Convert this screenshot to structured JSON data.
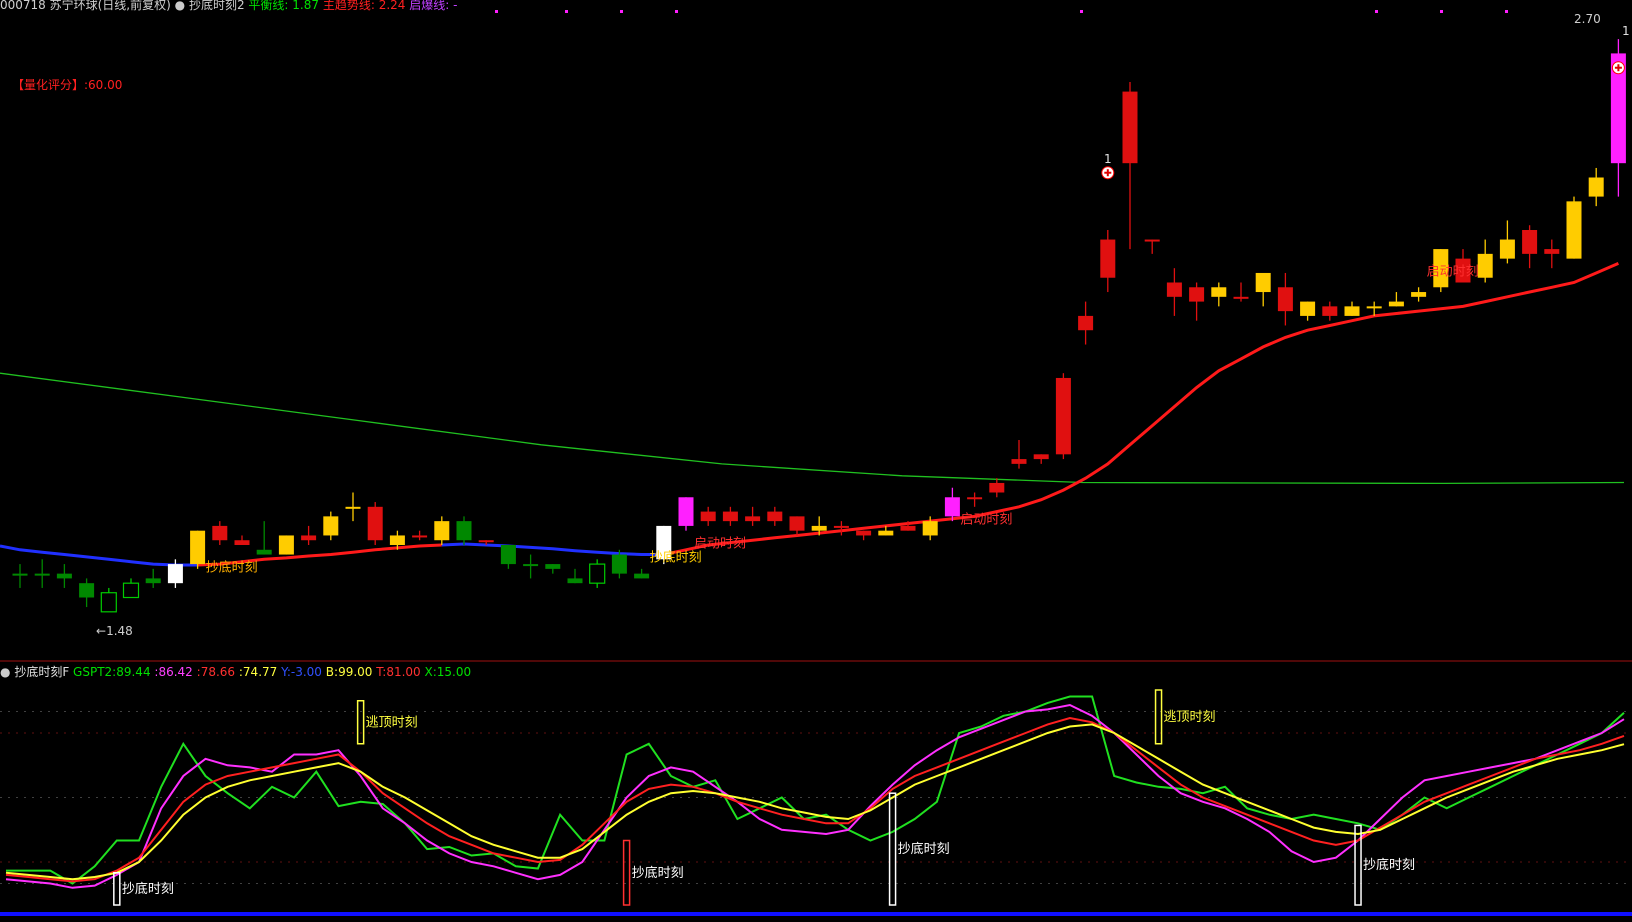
{
  "header": {
    "stock": "000718 苏宁环球(日线,前复权)",
    "indicator": "抄底时刻2",
    "items": [
      {
        "label": "平衡线:",
        "value": "1.87",
        "color": "#00e000"
      },
      {
        "label": "主趋势线:",
        "value": "2.24",
        "color": "#ff2020"
      },
      {
        "label": "启爆线:",
        "value": "-",
        "color": "#c040ff"
      }
    ]
  },
  "score": {
    "label": "【量化评分】:",
    "value": "60.00"
  },
  "price_labels": {
    "high_right": "2.70",
    "low": "1.48",
    "peak_mark": "1",
    "right_mark": "1"
  },
  "indicator_header": {
    "name": "抄底时刻F",
    "items": [
      {
        "label": "GSPT2:",
        "value": "89.44",
        "color": "#00e000"
      },
      {
        "label": ":",
        "value": "86.42",
        "color": "#ff40ff"
      },
      {
        "label": ":",
        "value": "78.66",
        "color": "#ff3030"
      },
      {
        "label": ":",
        "value": "74.77",
        "color": "#ffff40"
      },
      {
        "label": "Y:",
        "value": "-3.00",
        "color": "#3050ff"
      },
      {
        "label": "B:",
        "value": "99.00",
        "color": "#ffff40"
      },
      {
        "label": "T:",
        "value": "81.00",
        "color": "#ff3030"
      },
      {
        "label": "X:",
        "value": "15.00",
        "color": "#00e000"
      }
    ]
  },
  "signals": {
    "buy_label": "抄底时刻",
    "launch_label": "启动时刻",
    "top_label": "逃顶时刻"
  },
  "colors": {
    "up_red": "#e01010",
    "yellow": "#ffcc00",
    "magenta": "#ff20ff",
    "green": "#008800",
    "white": "#ffffff",
    "ma_green": "#20c020",
    "trend_red": "#ff1a1a",
    "trend_blue": "#2030ff"
  },
  "chart_data": {
    "type": "candlestick",
    "price_range": [
      1.4,
      2.72
    ],
    "candles": [
      {
        "o": 1.56,
        "h": 1.58,
        "l": 1.53,
        "c": 1.56,
        "col": "green"
      },
      {
        "o": 1.56,
        "h": 1.59,
        "l": 1.53,
        "c": 1.56,
        "col": "green"
      },
      {
        "o": 1.56,
        "h": 1.58,
        "l": 1.53,
        "c": 1.55,
        "col": "green"
      },
      {
        "o": 1.54,
        "h": 1.55,
        "l": 1.49,
        "c": 1.51,
        "col": "green"
      },
      {
        "o": 1.48,
        "h": 1.53,
        "l": 1.48,
        "c": 1.52,
        "col": "hollowgreen"
      },
      {
        "o": 1.51,
        "h": 1.55,
        "l": 1.51,
        "c": 1.54,
        "col": "hollowgreen"
      },
      {
        "o": 1.54,
        "h": 1.57,
        "l": 1.53,
        "c": 1.55,
        "col": "green"
      },
      {
        "o": 1.54,
        "h": 1.59,
        "l": 1.53,
        "c": 1.58,
        "col": "white"
      },
      {
        "o": 1.58,
        "h": 1.65,
        "l": 1.57,
        "c": 1.65,
        "col": "yellow"
      },
      {
        "o": 1.66,
        "h": 1.67,
        "l": 1.62,
        "c": 1.63,
        "col": "red"
      },
      {
        "o": 1.63,
        "h": 1.64,
        "l": 1.62,
        "c": 1.62,
        "col": "red"
      },
      {
        "o": 1.61,
        "h": 1.67,
        "l": 1.6,
        "c": 1.6,
        "col": "green"
      },
      {
        "o": 1.6,
        "h": 1.64,
        "l": 1.6,
        "c": 1.64,
        "col": "yellow"
      },
      {
        "o": 1.64,
        "h": 1.66,
        "l": 1.62,
        "c": 1.63,
        "col": "red"
      },
      {
        "o": 1.64,
        "h": 1.69,
        "l": 1.63,
        "c": 1.68,
        "col": "yellow"
      },
      {
        "o": 1.7,
        "h": 1.73,
        "l": 1.67,
        "c": 1.7,
        "col": "yellow"
      },
      {
        "o": 1.7,
        "h": 1.71,
        "l": 1.62,
        "c": 1.63,
        "col": "red"
      },
      {
        "o": 1.62,
        "h": 1.65,
        "l": 1.61,
        "c": 1.64,
        "col": "yellow"
      },
      {
        "o": 1.64,
        "h": 1.65,
        "l": 1.63,
        "c": 1.64,
        "col": "red"
      },
      {
        "o": 1.63,
        "h": 1.68,
        "l": 1.62,
        "c": 1.67,
        "col": "yellow"
      },
      {
        "o": 1.67,
        "h": 1.68,
        "l": 1.62,
        "c": 1.63,
        "col": "green"
      },
      {
        "o": 1.63,
        "h": 1.63,
        "l": 1.62,
        "c": 1.63,
        "col": "red"
      },
      {
        "o": 1.62,
        "h": 1.62,
        "l": 1.57,
        "c": 1.58,
        "col": "green"
      },
      {
        "o": 1.58,
        "h": 1.6,
        "l": 1.55,
        "c": 1.58,
        "col": "green"
      },
      {
        "o": 1.58,
        "h": 1.58,
        "l": 1.56,
        "c": 1.57,
        "col": "green"
      },
      {
        "o": 1.55,
        "h": 1.57,
        "l": 1.54,
        "c": 1.54,
        "col": "green"
      },
      {
        "o": 1.54,
        "h": 1.59,
        "l": 1.53,
        "c": 1.58,
        "col": "hollowgreen"
      },
      {
        "o": 1.6,
        "h": 1.61,
        "l": 1.55,
        "c": 1.56,
        "col": "green"
      },
      {
        "o": 1.56,
        "h": 1.57,
        "l": 1.55,
        "c": 1.55,
        "col": "green"
      },
      {
        "o": 1.59,
        "h": 1.66,
        "l": 1.58,
        "c": 1.66,
        "col": "white"
      },
      {
        "o": 1.66,
        "h": 1.72,
        "l": 1.65,
        "c": 1.72,
        "col": "magenta"
      },
      {
        "o": 1.69,
        "h": 1.7,
        "l": 1.66,
        "c": 1.67,
        "col": "red"
      },
      {
        "o": 1.69,
        "h": 1.7,
        "l": 1.66,
        "c": 1.67,
        "col": "red"
      },
      {
        "o": 1.68,
        "h": 1.7,
        "l": 1.66,
        "c": 1.67,
        "col": "red"
      },
      {
        "o": 1.69,
        "h": 1.7,
        "l": 1.66,
        "c": 1.67,
        "col": "red"
      },
      {
        "o": 1.68,
        "h": 1.68,
        "l": 1.64,
        "c": 1.65,
        "col": "red"
      },
      {
        "o": 1.65,
        "h": 1.68,
        "l": 1.64,
        "c": 1.66,
        "col": "yellow"
      },
      {
        "o": 1.66,
        "h": 1.67,
        "l": 1.64,
        "c": 1.66,
        "col": "red"
      },
      {
        "o": 1.65,
        "h": 1.65,
        "l": 1.63,
        "c": 1.64,
        "col": "red"
      },
      {
        "o": 1.64,
        "h": 1.66,
        "l": 1.64,
        "c": 1.65,
        "col": "yellow"
      },
      {
        "o": 1.66,
        "h": 1.67,
        "l": 1.65,
        "c": 1.65,
        "col": "red"
      },
      {
        "o": 1.64,
        "h": 1.68,
        "l": 1.63,
        "c": 1.67,
        "col": "yellow"
      },
      {
        "o": 1.68,
        "h": 1.74,
        "l": 1.67,
        "c": 1.72,
        "col": "magenta"
      },
      {
        "o": 1.72,
        "h": 1.73,
        "l": 1.7,
        "c": 1.72,
        "col": "red"
      },
      {
        "o": 1.73,
        "h": 1.76,
        "l": 1.72,
        "c": 1.75,
        "col": "red"
      },
      {
        "o": 1.79,
        "h": 1.84,
        "l": 1.78,
        "c": 1.8,
        "col": "red"
      },
      {
        "o": 1.8,
        "h": 1.81,
        "l": 1.79,
        "c": 1.81,
        "col": "red"
      },
      {
        "o": 1.81,
        "h": 1.98,
        "l": 1.8,
        "c": 1.97,
        "col": "red"
      },
      {
        "o": 2.1,
        "h": 2.13,
        "l": 2.04,
        "c": 2.07,
        "col": "red"
      },
      {
        "o": 2.26,
        "h": 2.28,
        "l": 2.15,
        "c": 2.18,
        "col": "red"
      },
      {
        "o": 2.57,
        "h": 2.59,
        "l": 2.24,
        "c": 2.42,
        "col": "red"
      },
      {
        "o": 2.26,
        "h": 2.26,
        "l": 2.23,
        "c": 2.26,
        "col": "red"
      },
      {
        "o": 2.17,
        "h": 2.2,
        "l": 2.1,
        "c": 2.14,
        "col": "red"
      },
      {
        "o": 2.16,
        "h": 2.17,
        "l": 2.09,
        "c": 2.13,
        "col": "red"
      },
      {
        "o": 2.14,
        "h": 2.17,
        "l": 2.12,
        "c": 2.16,
        "col": "yellow"
      },
      {
        "o": 2.14,
        "h": 2.17,
        "l": 2.13,
        "c": 2.14,
        "col": "red"
      },
      {
        "o": 2.15,
        "h": 2.18,
        "l": 2.12,
        "c": 2.19,
        "col": "yellow"
      },
      {
        "o": 2.16,
        "h": 2.19,
        "l": 2.08,
        "c": 2.11,
        "col": "red"
      },
      {
        "o": 2.1,
        "h": 2.13,
        "l": 2.09,
        "c": 2.13,
        "col": "yellow"
      },
      {
        "o": 2.12,
        "h": 2.13,
        "l": 2.09,
        "c": 2.1,
        "col": "red"
      },
      {
        "o": 2.1,
        "h": 2.13,
        "l": 2.1,
        "c": 2.12,
        "col": "yellow"
      },
      {
        "o": 2.12,
        "h": 2.13,
        "l": 2.1,
        "c": 2.12,
        "col": "yellow"
      },
      {
        "o": 2.12,
        "h": 2.15,
        "l": 2.12,
        "c": 2.13,
        "col": "yellow"
      },
      {
        "o": 2.14,
        "h": 2.16,
        "l": 2.13,
        "c": 2.15,
        "col": "yellow"
      },
      {
        "o": 2.16,
        "h": 2.24,
        "l": 2.15,
        "c": 2.24,
        "col": "yellow"
      },
      {
        "o": 2.22,
        "h": 2.24,
        "l": 2.18,
        "c": 2.17,
        "col": "red"
      },
      {
        "o": 2.18,
        "h": 2.26,
        "l": 2.17,
        "c": 2.23,
        "col": "yellow"
      },
      {
        "o": 2.22,
        "h": 2.3,
        "l": 2.21,
        "c": 2.26,
        "col": "yellow"
      },
      {
        "o": 2.28,
        "h": 2.29,
        "l": 2.2,
        "c": 2.23,
        "col": "red"
      },
      {
        "o": 2.24,
        "h": 2.26,
        "l": 2.2,
        "c": 2.23,
        "col": "red"
      },
      {
        "o": 2.22,
        "h": 2.35,
        "l": 2.22,
        "c": 2.34,
        "col": "yellow"
      },
      {
        "o": 2.35,
        "h": 2.41,
        "l": 2.33,
        "c": 2.39,
        "col": "yellow"
      },
      {
        "o": 2.42,
        "h": 2.68,
        "l": 2.35,
        "c": 2.65,
        "col": "magenta"
      }
    ],
    "ma_long": [
      1.98,
      1.93,
      1.88,
      1.83,
      1.79,
      1.765,
      1.751,
      1.75,
      1.749,
      1.751
    ],
    "trend_line": [
      1.61,
      1.605,
      1.6,
      1.595,
      1.59,
      1.585,
      1.58,
      1.578,
      1.578,
      1.58,
      1.585,
      1.59,
      1.593,
      1.597,
      1.6,
      1.605,
      1.61,
      1.614,
      1.618,
      1.62,
      1.622,
      1.62,
      1.618,
      1.615,
      1.612,
      1.608,
      1.605,
      1.602,
      1.6,
      1.6,
      1.61,
      1.62,
      1.625,
      1.63,
      1.635,
      1.64,
      1.645,
      1.65,
      1.655,
      1.66,
      1.665,
      1.67,
      1.675,
      1.68,
      1.69,
      1.7,
      1.715,
      1.735,
      1.76,
      1.79,
      1.83,
      1.87,
      1.91,
      1.95,
      1.985,
      2.01,
      2.035,
      2.055,
      2.07,
      2.08,
      2.09,
      2.1,
      2.105,
      2.11,
      2.115,
      2.12,
      2.13,
      2.14,
      2.15,
      2.16,
      2.17,
      2.19,
      2.21
    ],
    "gspt2_last": 89.44,
    "ind_green": [
      16,
      16,
      16,
      10,
      18,
      30,
      30,
      55,
      75,
      60,
      52,
      45,
      55,
      50,
      62,
      46,
      48,
      47,
      38,
      26,
      27,
      23,
      24,
      18,
      17,
      42,
      30,
      30,
      70,
      75,
      60,
      55,
      58,
      40,
      45,
      50,
      40,
      42,
      35,
      30,
      34,
      40,
      48,
      80,
      83,
      88,
      90,
      94,
      97,
      97,
      60,
      57,
      55,
      54,
      52,
      55,
      45,
      42,
      40,
      42,
      40,
      38,
      35,
      42,
      50,
      45,
      50,
      55,
      60,
      65,
      70,
      75,
      80,
      89.44
    ],
    "ind_magenta": [
      12,
      11,
      10,
      8,
      9,
      14,
      20,
      45,
      60,
      68,
      65,
      64,
      62,
      70,
      70,
      72,
      60,
      45,
      38,
      30,
      24,
      20,
      18,
      15,
      12,
      14,
      20,
      35,
      50,
      60,
      64,
      62,
      55,
      48,
      40,
      35,
      34,
      33,
      35,
      46,
      56,
      65,
      72,
      78,
      82,
      86,
      90,
      91,
      93,
      88,
      80,
      70,
      60,
      52,
      48,
      45,
      40,
      34,
      25,
      20,
      22,
      30,
      40,
      50,
      58,
      60,
      62,
      64,
      66,
      68,
      72,
      76,
      80,
      86.42
    ],
    "ind_red": [
      14,
      13,
      12,
      11,
      12,
      16,
      22,
      35,
      48,
      56,
      60,
      62,
      64,
      66,
      68,
      70,
      62,
      52,
      45,
      38,
      32,
      28,
      24,
      22,
      20,
      21,
      28,
      38,
      48,
      54,
      56,
      55,
      52,
      48,
      45,
      42,
      40,
      38,
      38,
      45,
      54,
      60,
      64,
      68,
      72,
      76,
      80,
      84,
      87,
      85,
      80,
      72,
      64,
      56,
      50,
      46,
      42,
      38,
      34,
      30,
      28,
      30,
      36,
      42,
      48,
      52,
      56,
      60,
      64,
      68,
      70,
      72,
      75,
      78.66
    ],
    "ind_yellow": [
      15,
      14,
      13,
      12,
      13,
      15,
      20,
      30,
      42,
      50,
      55,
      58,
      60,
      62,
      64,
      66,
      62,
      55,
      50,
      44,
      38,
      32,
      28,
      25,
      22,
      22,
      26,
      34,
      42,
      48,
      52,
      53,
      52,
      50,
      48,
      45,
      43,
      41,
      40,
      44,
      50,
      56,
      60,
      64,
      68,
      72,
      76,
      80,
      83,
      84,
      80,
      74,
      68,
      62,
      56,
      52,
      48,
      44,
      40,
      36,
      34,
      33,
      35,
      40,
      45,
      50,
      54,
      58,
      62,
      65,
      68,
      70,
      72,
      74.77
    ]
  }
}
